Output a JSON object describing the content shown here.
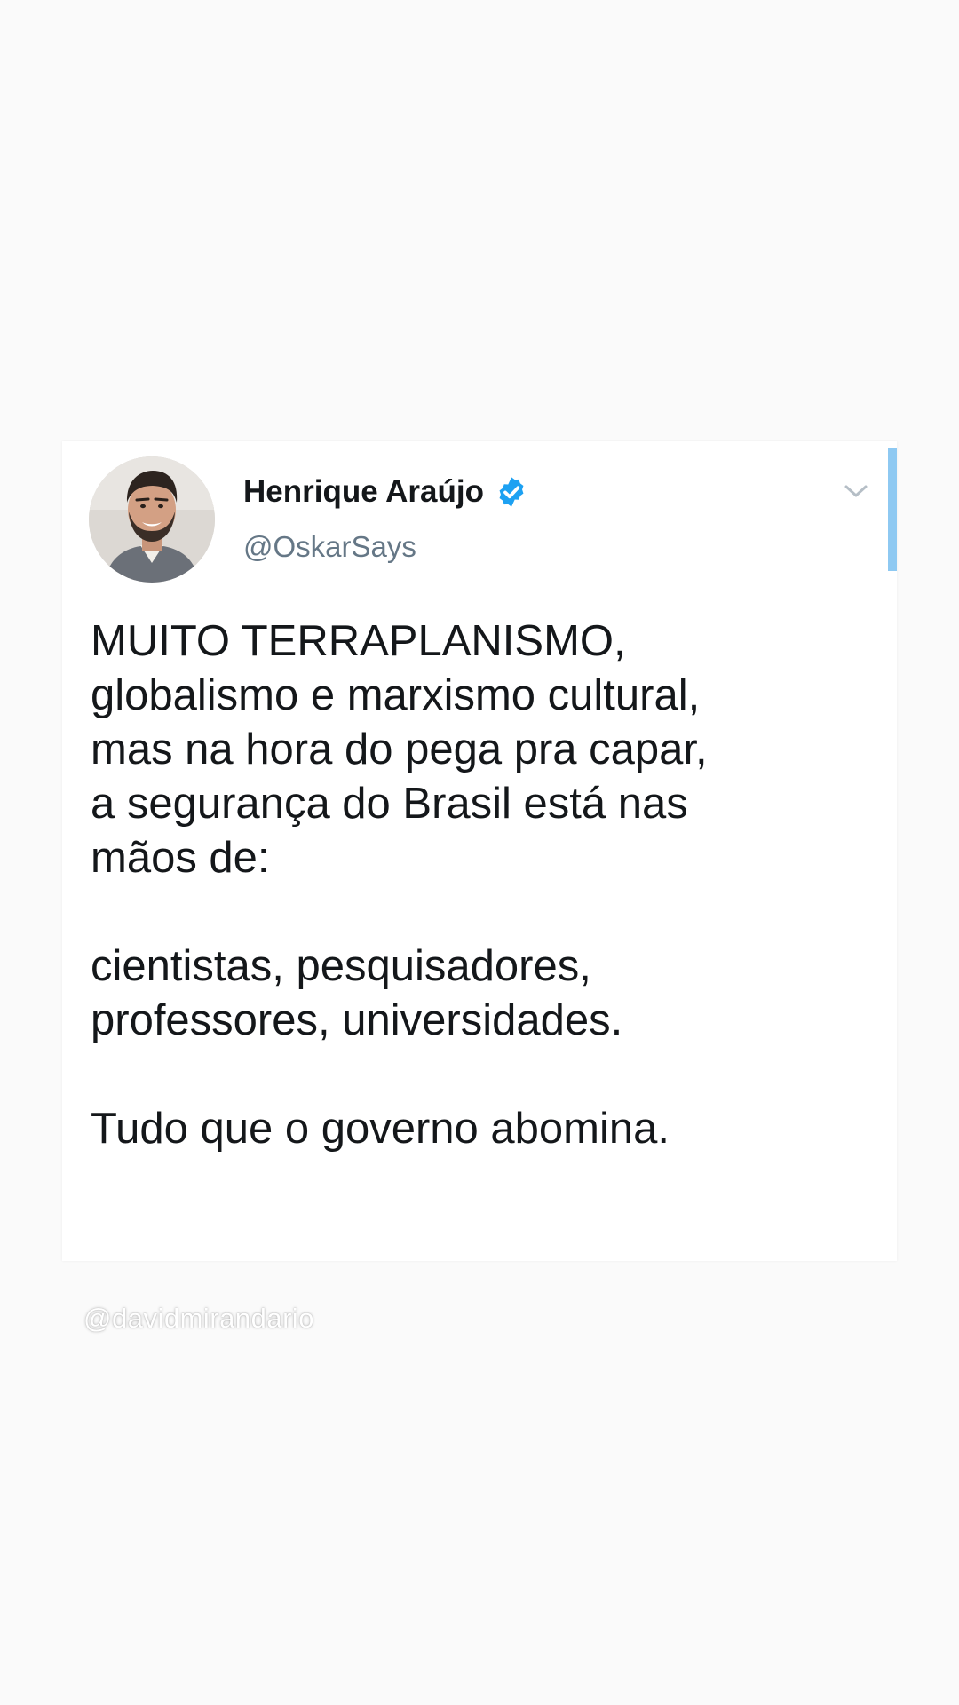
{
  "tweet": {
    "author": {
      "display_name": "Henrique Araújo",
      "handle": "@OskarSays",
      "verified": true,
      "avatar_icon": "user-avatar"
    },
    "menu_icon": "chevron-down-icon",
    "paragraphs": [
      {
        "lines": [
          "MUITO TERRAPLANISMO,",
          "globalismo e marxismo cultural,",
          "mas na hora do pega pra capar,",
          "a segurança do Brasil está nas",
          "mãos de:"
        ]
      },
      {
        "lines": [
          "cientistas, pesquisadores,",
          "professores, universidades."
        ]
      },
      {
        "lines": [
          "Tudo que o governo abomina."
        ]
      }
    ]
  },
  "watermark": {
    "text": "@davidmirandario"
  },
  "colors": {
    "background": "#fafafa",
    "card": "#ffffff",
    "verified_blue": "#1da1f2",
    "scroll_indicator": "#8ec9f2",
    "handle_gray": "#657786",
    "text_dark": "#14171a"
  }
}
